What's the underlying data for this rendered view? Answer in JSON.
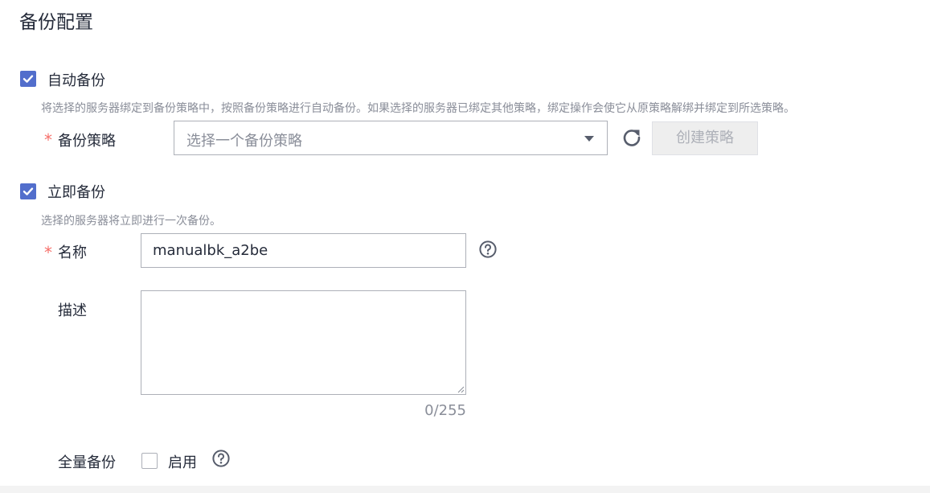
{
  "title": "备份配置",
  "auto_backup": {
    "checked": true,
    "label": "自动备份",
    "hint": "将选择的服务器绑定到备份策略中，按照备份策略进行自动备份。如果选择的服务器已绑定其他策略，绑定操作会使它从原策略解绑并绑定到所选策略。",
    "policy_required_mark": "*",
    "policy_label": "备份策略",
    "policy_placeholder": "选择一个备份策略",
    "refresh_icon": "refresh-icon",
    "create_policy_label": "创建策略"
  },
  "immediate_backup": {
    "checked": true,
    "label": "立即备份",
    "hint": "选择的服务器将立即进行一次备份。",
    "name_required_mark": "*",
    "name_label": "名称",
    "name_value": "manualbk_a2be",
    "help_icon": "question-circle-icon",
    "desc_label": "描述",
    "desc_value": "",
    "desc_counter": "0/255"
  },
  "full_backup": {
    "label": "全量备份",
    "enable_checked": false,
    "enable_label": "启用",
    "help_icon": "question-circle-icon"
  },
  "colors": {
    "accent": "#526ecc",
    "required": "#f66f6a",
    "hint": "#8a8e99"
  }
}
